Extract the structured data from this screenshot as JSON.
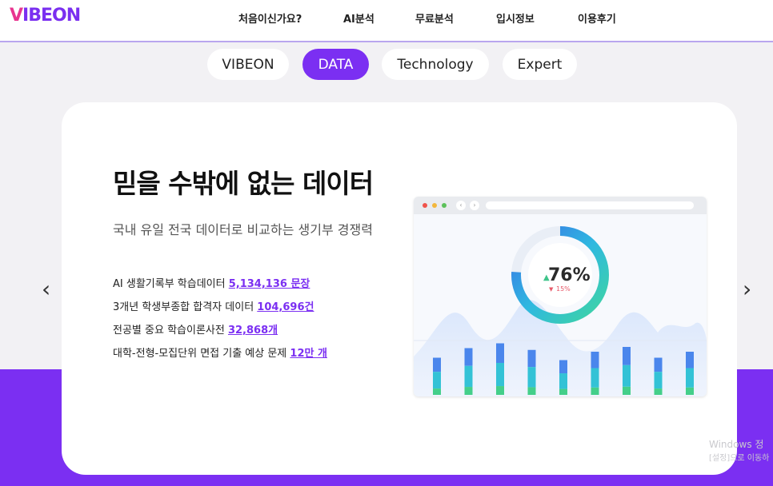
{
  "logo": {
    "prefix": "V",
    "rest": "ibeon"
  },
  "nav": [
    "처음이신가요?",
    "AI분석",
    "무료분석",
    "입시정보",
    "이용후기"
  ],
  "tabs": [
    {
      "label": "VIBEON",
      "active": false
    },
    {
      "label": "DATA",
      "active": true
    },
    {
      "label": "Technology",
      "active": false
    },
    {
      "label": "Expert",
      "active": false
    }
  ],
  "card": {
    "title": "믿을 수밖에 없는 데이터",
    "subtitle": "국내 유일 전국 데이터로 비교하는 생기부 경쟁력",
    "stats": [
      {
        "text": "AI 생활기록부 학습데이터 ",
        "highlight": "5,134,136 문장"
      },
      {
        "text": "3개년 학생부종합 합격자 데이터 ",
        "highlight": "104,696건"
      },
      {
        "text": "전공별 중요 학습이론사전 ",
        "highlight": "32,868개"
      },
      {
        "text": "대학-전형-모집단위 면접 기출 예상 문제 ",
        "highlight": "12만 개"
      }
    ]
  },
  "mockup": {
    "gauge_percent": 76,
    "gauge_label": "76%",
    "sub_label": "15%",
    "bar_values": [
      0.62,
      0.78,
      0.86,
      0.75,
      0.58,
      0.72,
      0.8,
      0.62,
      0.72
    ]
  },
  "watermark": {
    "line1": "Windows 정",
    "line2": "[설정]으로 이동하"
  },
  "icons": {
    "prev": "chevron-left-icon",
    "next": "chevron-right-icon"
  }
}
